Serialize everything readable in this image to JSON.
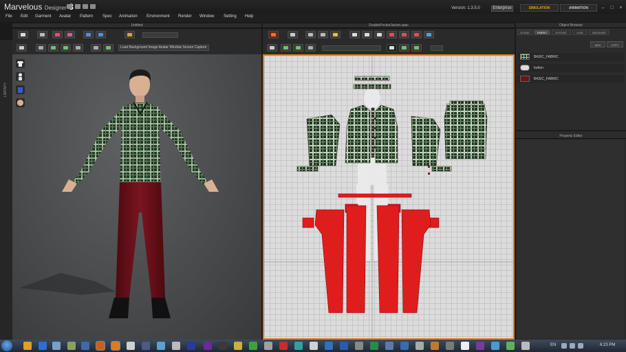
{
  "app": {
    "logo_main": "Marvelous",
    "logo_sub": "Designer",
    "logo_ver": "3",
    "version_text": "Version: 1.3.5.0",
    "edition": "Enterprise",
    "mode_simulation": "SIMULATION",
    "mode_animation": "ANIMATION"
  },
  "menu": [
    "File",
    "Edit",
    "Garment",
    "Avatar",
    "Pattern",
    "Spec",
    "Animation",
    "Environment",
    "Render",
    "Window",
    "Setting",
    "Help"
  ],
  "view3d": {
    "title": "Untitled",
    "toolbar_text": "Load Background Image Avatar Window Screen Capture",
    "library_label": "LIBRARY"
  },
  "view2d": {
    "title": "DoublePocketJacket.zpac"
  },
  "object_browser": {
    "title": "Object Browser",
    "tabs": [
      "SCENE",
      "FABRIC",
      "B-POINT",
      "A-BV",
      "MEASURE"
    ],
    "active_tab": "FABRIC",
    "add_label": "ADD",
    "copy_label": "COPY",
    "fabrics": [
      {
        "name": "BASIC_FABRIC",
        "swatch": "#1f3a24"
      },
      {
        "name": "button",
        "swatch": "#dcdcdc"
      },
      {
        "name": "BASIC_FABRIC",
        "swatch": "#6a1414"
      }
    ]
  },
  "property_editor": {
    "title": "Property Editor"
  },
  "taskbar": {
    "language": "EN",
    "clock": "6:23 PM"
  },
  "colors": {
    "accent": "#e07a20",
    "plaid_base": "#1f3a24",
    "pants": "#e01d1d",
    "pants_3d": "#6b1018"
  }
}
